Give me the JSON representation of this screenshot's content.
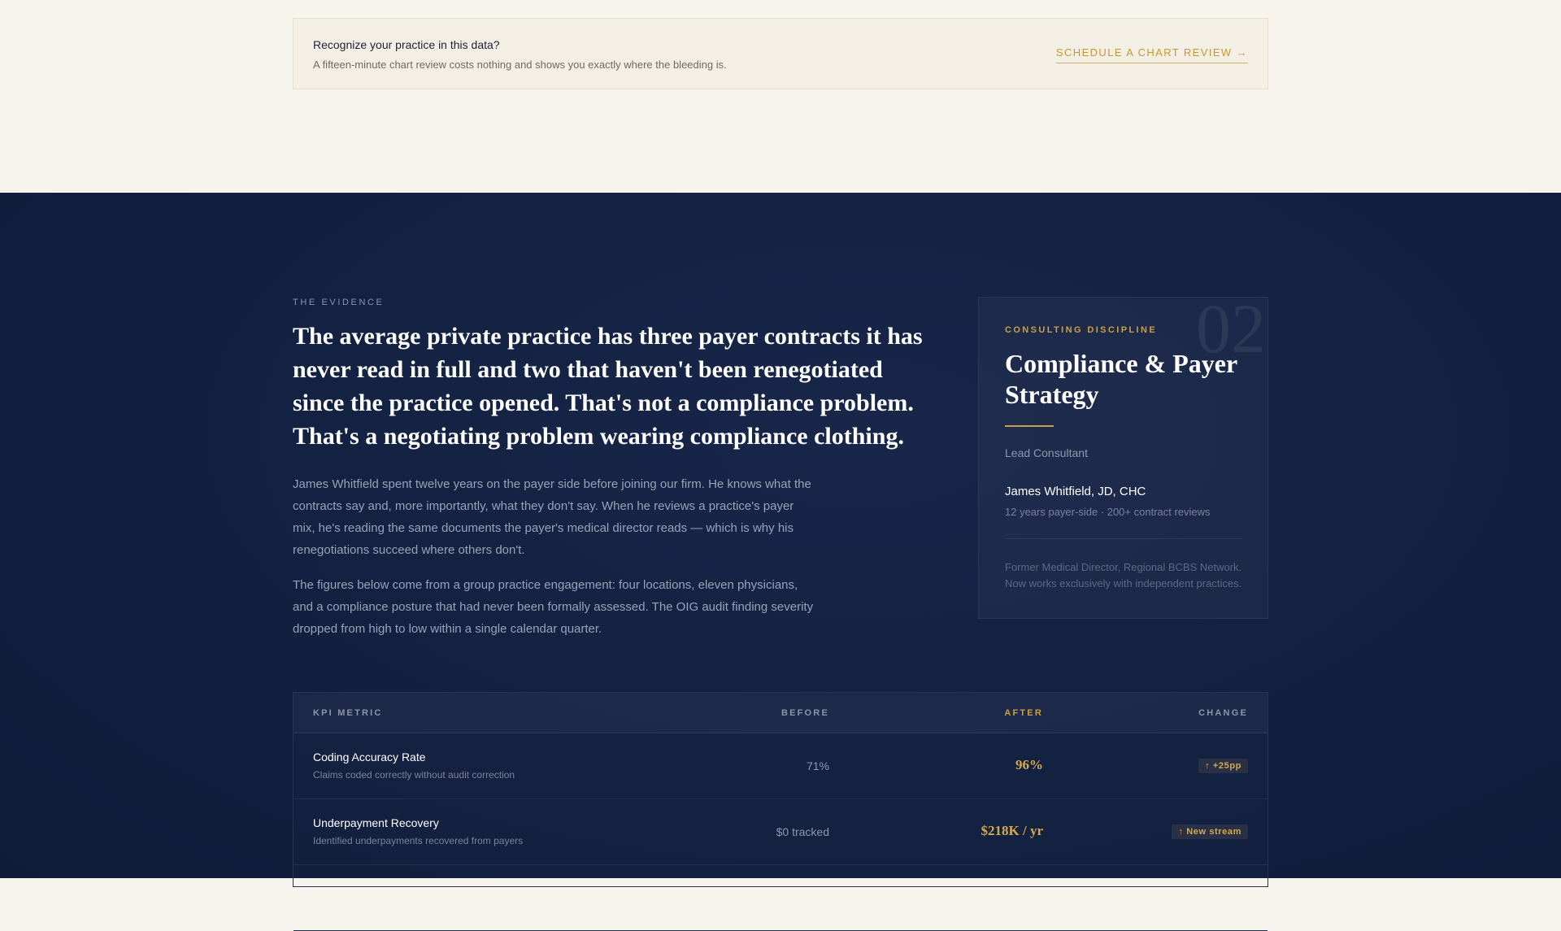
{
  "cta": {
    "title": "Recognize your practice in this data?",
    "subtitle": "A fifteen-minute chart review costs nothing and shows you exactly where the bleeding is.",
    "link_label": "SCHEDULE A CHART REVIEW →"
  },
  "evidence": {
    "eyebrow": "THE EVIDENCE",
    "headline": "The average private practice has three payer contracts it has never read in full and two that haven't been renegotiated since the practice opened. That's not a compliance problem. That's a negotiating problem wearing compliance clothing.",
    "paragraph_1": "James Whitfield spent twelve years on the payer side before joining our firm. He knows what the contracts say and, more importantly, what they don't say. When he reviews a practice's payer mix, he's reading the same documents the payer's medical director reads — which is why his renegotiations succeed where others don't.",
    "paragraph_2": "The figures below come from a group practice engagement: four locations, eleven physicians, and a compliance posture that had never been formally assessed. The OIG audit finding severity dropped from high to low within a single calendar quarter."
  },
  "card": {
    "number": "02",
    "eyebrow": "CONSULTING DISCIPLINE",
    "title": "Compliance & Payer Strategy",
    "role": "Lead Consultant",
    "name": "James Whitfield, JD, CHC",
    "credentials": "12 years payer-side · 200+ contract reviews",
    "bio": "Former Medical Director, Regional BCBS Network. Now works exclusively with independent practices."
  },
  "kpi_table": {
    "headers": {
      "metric": "KPI METRIC",
      "before": "BEFORE",
      "after": "AFTER",
      "change": "CHANGE"
    },
    "rows": [
      {
        "name": "Coding Accuracy Rate",
        "description": "Claims coded correctly without audit correction",
        "before": "71%",
        "after": "96%",
        "change": "↑ +25pp"
      },
      {
        "name": "Underpayment Recovery",
        "description": "Identified underpayments recovered from payers",
        "before": "$0 tracked",
        "after": "$218K / yr",
        "change": "↑ New stream"
      }
    ]
  },
  "colors": {
    "navy_background": "#132142",
    "gold_accent": "#c9a043",
    "cream_background": "#f7f4ee"
  }
}
